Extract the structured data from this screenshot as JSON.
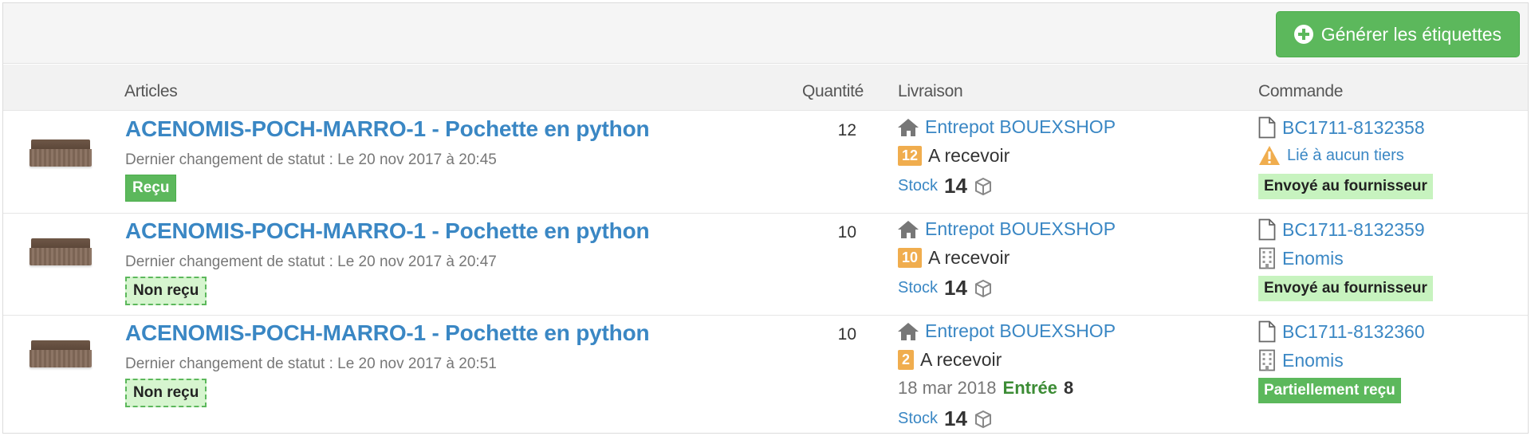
{
  "toolbar": {
    "generate_label": "Générer les étiquettes",
    "generate_icon": "plus-circle-icon"
  },
  "columns": {
    "articles": "Articles",
    "quantite": "Quantité",
    "livraison": "Livraison",
    "commande": "Commande"
  },
  "rows": [
    {
      "title": "ACENOMIS-POCH-MARRO-1 - Pochette en python",
      "status_change": "Dernier changement de statut : Le 20 nov 2017 à 20:45",
      "status": "Reçu",
      "quantity": "12",
      "warehouse": "Entrepot BOUEXSHOP",
      "to_receive_count": "12",
      "to_receive_label": "A recevoir",
      "stock_label": "Stock",
      "stock_value": "14",
      "order_ref": "BC1711-8132358",
      "third_party": "Lié à aucun tiers",
      "order_status": "Envoyé au fournisseur"
    },
    {
      "title": "ACENOMIS-POCH-MARRO-1 - Pochette en python",
      "status_change": "Dernier changement de statut : Le 20 nov 2017 à 20:47",
      "status": "Non reçu",
      "quantity": "10",
      "warehouse": "Entrepot BOUEXSHOP",
      "to_receive_count": "10",
      "to_receive_label": "A recevoir",
      "stock_label": "Stock",
      "stock_value": "14",
      "order_ref": "BC1711-8132359",
      "third_party": "Enomis",
      "order_status": "Envoyé au fournisseur"
    },
    {
      "title": "ACENOMIS-POCH-MARRO-1 - Pochette en python",
      "status_change": "Dernier changement de statut : Le 20 nov 2017 à 20:51",
      "status": "Non reçu",
      "quantity": "10",
      "warehouse": "Entrepot BOUEXSHOP",
      "to_receive_count": "2",
      "to_receive_label": "A recevoir",
      "entry_date": "18 mar 2018",
      "entry_label": "Entrée",
      "entry_value": "8",
      "stock_label": "Stock",
      "stock_value": "14",
      "order_ref": "BC1711-8132360",
      "third_party": "Enomis",
      "order_status": "Partiellement reçu"
    }
  ],
  "colors": {
    "link": "#3a87c4",
    "success": "#5cb85c",
    "warning": "#f0ad4e",
    "entry": "#3c8c35"
  }
}
